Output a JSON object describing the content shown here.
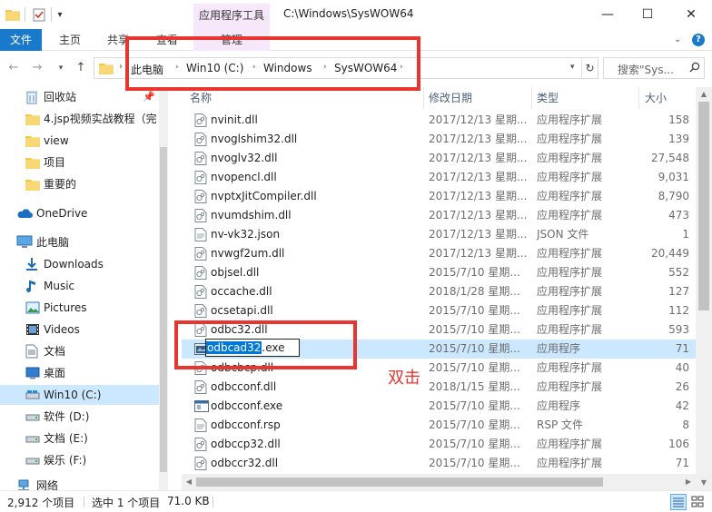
{
  "window": {
    "context_tab": "应用程序工具",
    "path_title": "C:\\Windows\\SysWOW64",
    "minimize": "—",
    "maximize": "☐",
    "close": "✕"
  },
  "ribbon": {
    "tabs": [
      "文件",
      "主页",
      "共享",
      "查看",
      "管理"
    ],
    "expand": "⌄",
    "help": "?"
  },
  "address": {
    "crumbs": [
      "此电脑",
      "Win10 (C:)",
      "Windows",
      "SysWOW64"
    ],
    "search_placeholder": "搜索\"Sys...",
    "refresh": "↻"
  },
  "nav": {
    "items": [
      {
        "label": "回收站",
        "icon": "recycle-bin-icon",
        "pinned": true
      },
      {
        "label": "4.jsp视频实战教程（完",
        "icon": "folder-icon"
      },
      {
        "label": "view",
        "icon": "folder-icon"
      },
      {
        "label": "项目",
        "icon": "folder-icon"
      },
      {
        "label": "重要的",
        "icon": "folder-icon"
      },
      {
        "label": "OneDrive",
        "icon": "cloud-icon"
      },
      {
        "label": "此电脑",
        "icon": "computer-icon"
      },
      {
        "label": "Downloads",
        "icon": "download-icon"
      },
      {
        "label": "Music",
        "icon": "music-icon"
      },
      {
        "label": "Pictures",
        "icon": "pictures-icon"
      },
      {
        "label": "Videos",
        "icon": "videos-icon"
      },
      {
        "label": "文档",
        "icon": "documents-icon"
      },
      {
        "label": "桌面",
        "icon": "desktop-icon"
      },
      {
        "label": "Win10 (C:)",
        "icon": "drive-icon",
        "selected": true
      },
      {
        "label": "软件 (D:)",
        "icon": "drive-icon"
      },
      {
        "label": "文档 (E:)",
        "icon": "drive-icon"
      },
      {
        "label": "娱乐 (F:)",
        "icon": "drive-icon"
      },
      {
        "label": "网络",
        "icon": "network-icon"
      }
    ]
  },
  "columns": {
    "name": "名称",
    "date": "修改日期",
    "type": "类型",
    "size": "大小"
  },
  "files": [
    {
      "name": "nvinit.dll",
      "date": "2017/12/13 星期...",
      "type": "应用程序扩展",
      "size": "158"
    },
    {
      "name": "nvoglshim32.dll",
      "date": "2017/12/13 星期...",
      "type": "应用程序扩展",
      "size": "139"
    },
    {
      "name": "nvoglv32.dll",
      "date": "2017/12/13 星期...",
      "type": "应用程序扩展",
      "size": "27,548"
    },
    {
      "name": "nvopencl.dll",
      "date": "2017/12/13 星期...",
      "type": "应用程序扩展",
      "size": "9,031"
    },
    {
      "name": "nvptxJitCompiler.dll",
      "date": "2017/12/13 星期...",
      "type": "应用程序扩展",
      "size": "8,790"
    },
    {
      "name": "nvumdshim.dll",
      "date": "2017/12/13 星期...",
      "type": "应用程序扩展",
      "size": "473"
    },
    {
      "name": "nv-vk32.json",
      "date": "2017/12/13 星期...",
      "type": "JSON 文件",
      "size": "1"
    },
    {
      "name": "nvwgf2um.dll",
      "date": "2017/12/13 星期...",
      "type": "应用程序扩展",
      "size": "20,449"
    },
    {
      "name": "objsel.dll",
      "date": "2015/7/10 星期...",
      "type": "应用程序扩展",
      "size": "552"
    },
    {
      "name": "occache.dll",
      "date": "2018/1/28 星期...",
      "type": "应用程序扩展",
      "size": "127"
    },
    {
      "name": "ocsetapi.dll",
      "date": "2015/7/10 星期...",
      "type": "应用程序扩展",
      "size": "112"
    },
    {
      "name": "odbc32.dll",
      "date": "2015/7/10 星期...",
      "type": "应用程序扩展",
      "size": "593"
    },
    {
      "name": "odbcad32.exe",
      "date": "2015/7/10 星期...",
      "type": "应用程序",
      "size": "71",
      "selected": true
    },
    {
      "name": "odbcbcp.dll",
      "date": "2015/7/10 星期...",
      "type": "应用程序扩展",
      "size": "40"
    },
    {
      "name": "odbcconf.dll",
      "date": "2018/1/15 星期...",
      "type": "应用程序扩展",
      "size": "26"
    },
    {
      "name": "odbcconf.exe",
      "date": "2015/7/10 星期...",
      "type": "应用程序",
      "size": "42"
    },
    {
      "name": "odbcconf.rsp",
      "date": "2015/7/10 星期...",
      "type": "RSP 文件",
      "size": "8"
    },
    {
      "name": "odbccp32.dll",
      "date": "2015/7/10 星期...",
      "type": "应用程序扩展",
      "size": "106"
    },
    {
      "name": "odbccr32.dll",
      "date": "2015/7/10 星期...",
      "type": "应用程序扩展",
      "size": "71"
    }
  ],
  "rename": {
    "selected_part": "odbcad32",
    "extension": ".exe"
  },
  "annotation": {
    "label": "双击",
    "color": "#e8352f"
  },
  "status": {
    "count": "2,912 个项目",
    "selection": "选中 1 个项目",
    "size": "71.0 KB"
  },
  "colors": {
    "accent": "#1979ca",
    "selection": "#cce8ff",
    "context_tab": "#f6e8fa"
  }
}
